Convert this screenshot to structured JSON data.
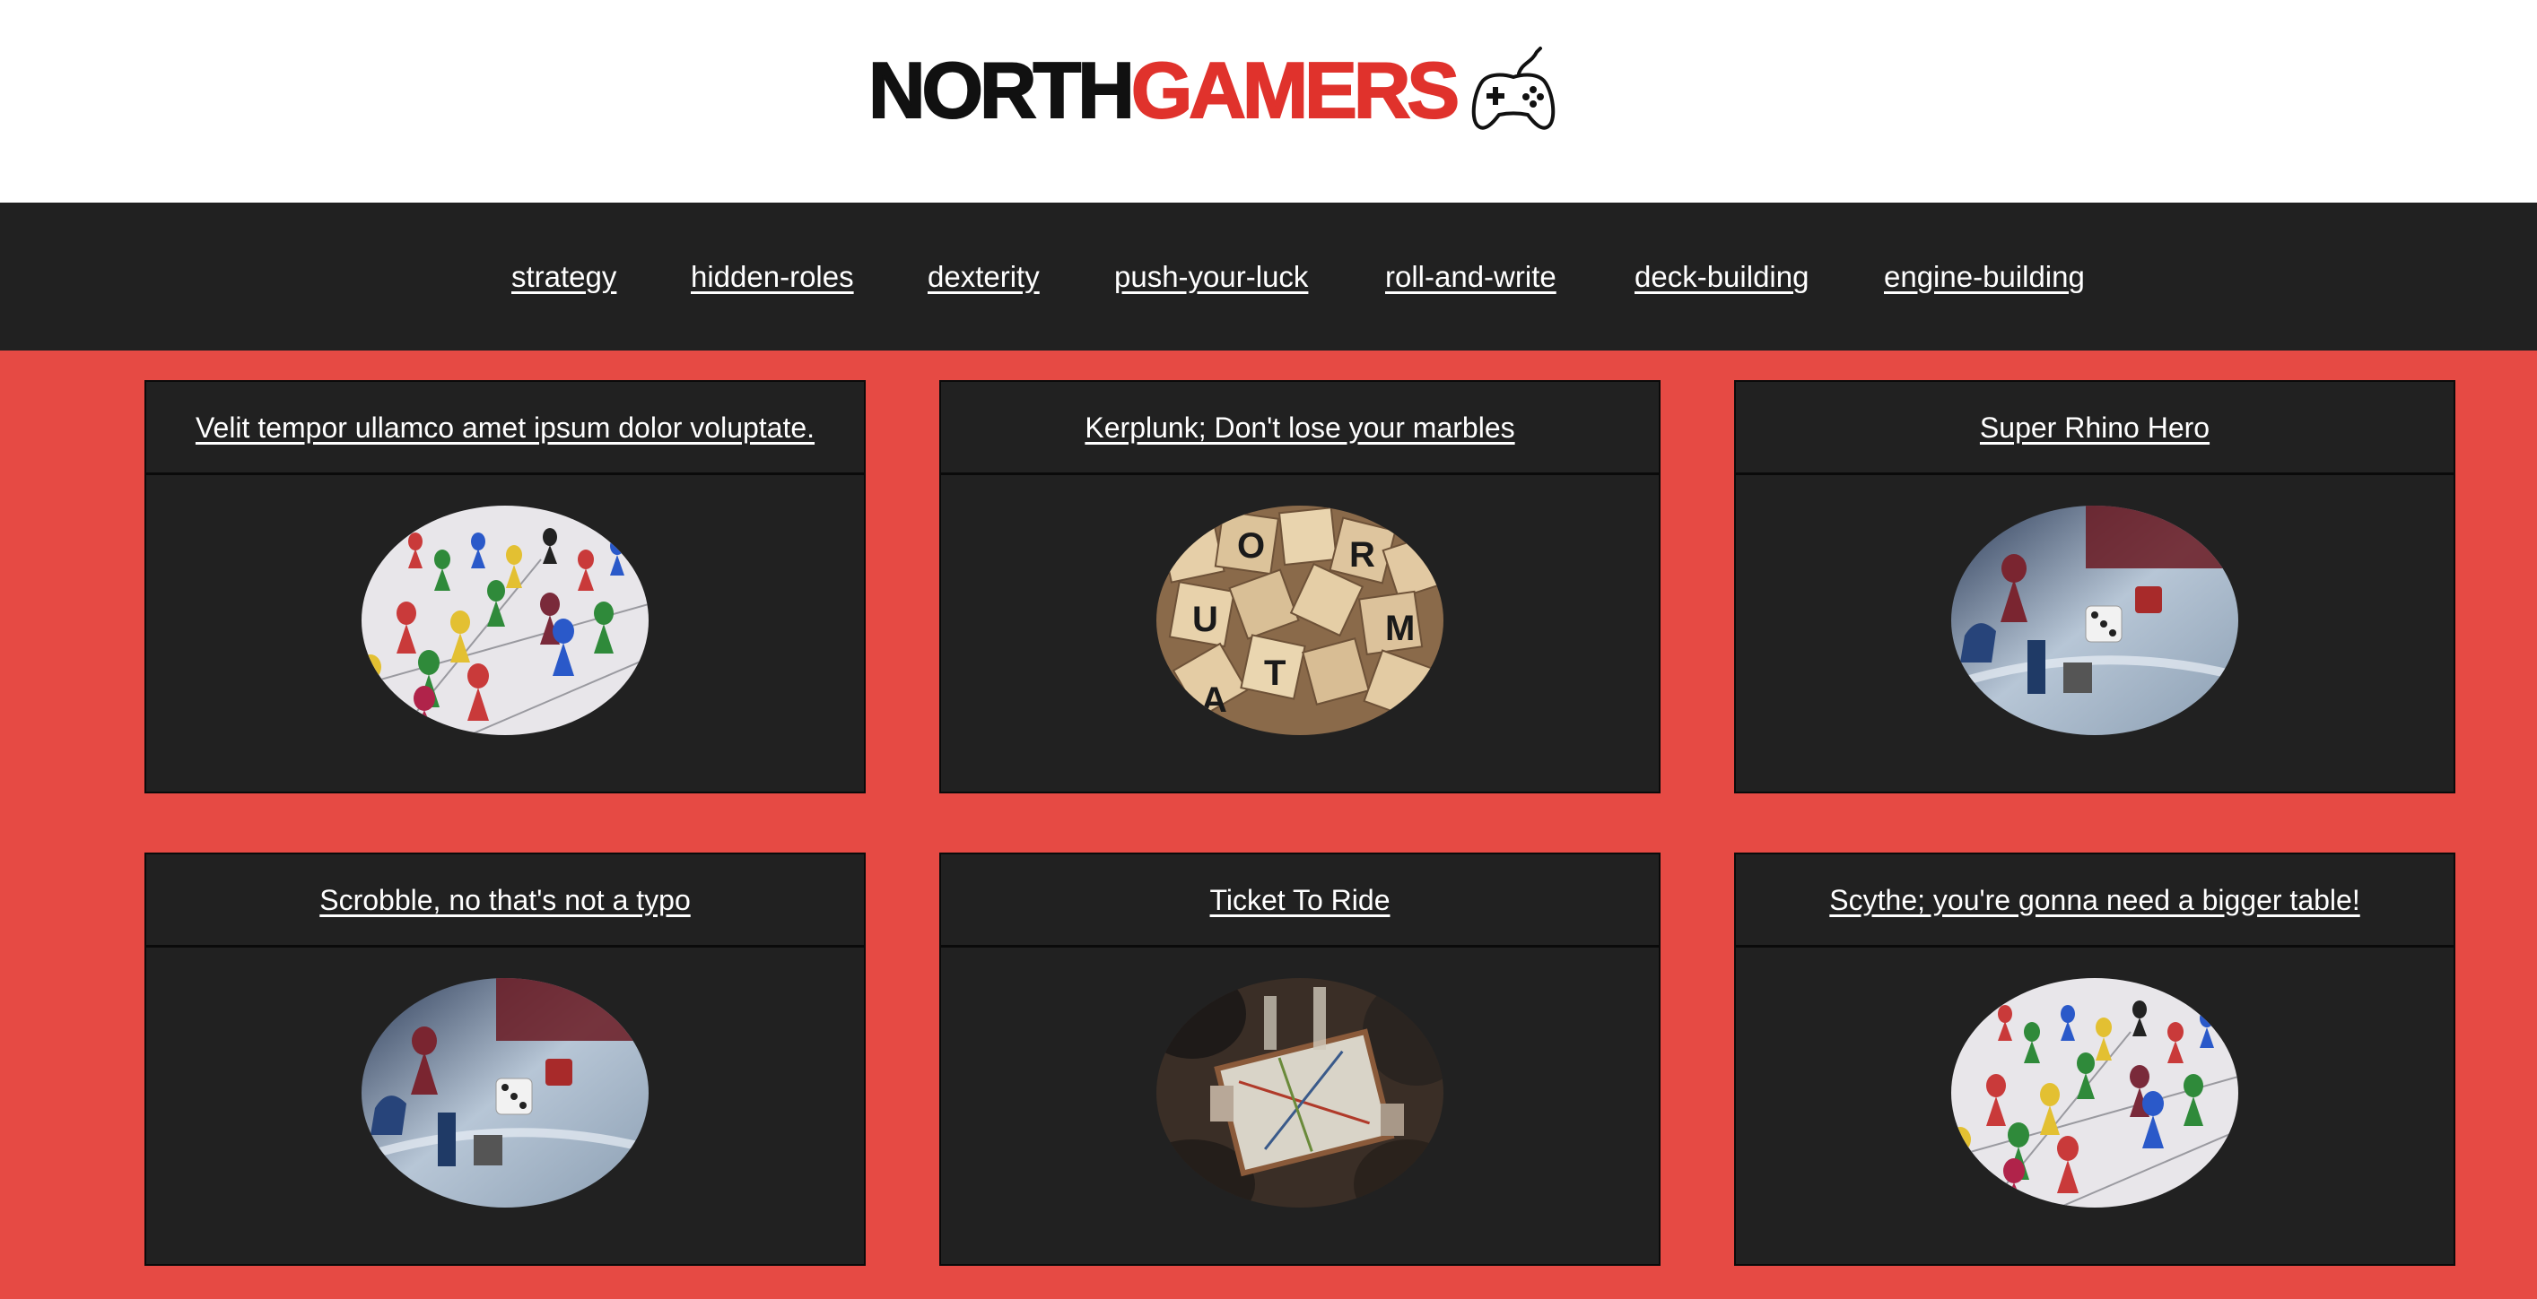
{
  "brand": {
    "part1": "NORTH",
    "part2": "GAMERS",
    "icon": "gamepad-icon",
    "colors": {
      "dark": "#111111",
      "accent": "#e0322c"
    }
  },
  "nav": {
    "items": [
      {
        "label": "strategy"
      },
      {
        "label": "hidden-roles"
      },
      {
        "label": "dexterity"
      },
      {
        "label": "push-your-luck"
      },
      {
        "label": "roll-and-write"
      },
      {
        "label": "deck-building"
      },
      {
        "label": "engine-building"
      }
    ]
  },
  "cards": [
    {
      "title": "Velit tempor ullamco amet ipsum dolor voluptate.",
      "image": "board-game-pawns-photo"
    },
    {
      "title": "Kerplunk; Don't lose your marbles",
      "image": "letter-tiles-photo"
    },
    {
      "title": "Super Rhino Hero",
      "image": "game-pieces-dice-photo"
    },
    {
      "title": "Scrobble, no that's not a typo",
      "image": "game-pieces-dice-photo"
    },
    {
      "title": "Ticket To Ride",
      "image": "players-at-board-photo"
    },
    {
      "title": "Scythe; you're gonna need a bigger table!",
      "image": "board-game-pawns-photo"
    }
  ],
  "colors": {
    "page_background": "#e64a44",
    "nav_background": "#212121",
    "card_background": "#212121"
  }
}
